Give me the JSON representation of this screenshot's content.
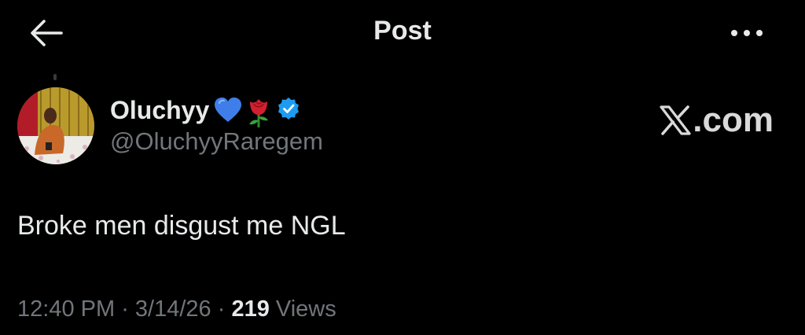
{
  "header": {
    "title": "Post"
  },
  "post": {
    "author": {
      "display_name": "Oluchyy",
      "emojis": [
        "blue-heart-icon",
        "rose-icon"
      ],
      "verified": true,
      "handle": "@OluchyyRaregem"
    },
    "watermark": ".com",
    "text": "Broke men disgust me NGL",
    "time": "12:40 PM",
    "separator": " · ",
    "date": "3/14/26",
    "views_count": "219",
    "views_label": " Views"
  },
  "colors": {
    "background": "#000000",
    "text_primary": "#e7e9ea",
    "text_secondary": "#71767b",
    "verified_badge": "#1d9bf0",
    "heart": "#3f7ee8",
    "rose": "#d1202f"
  }
}
